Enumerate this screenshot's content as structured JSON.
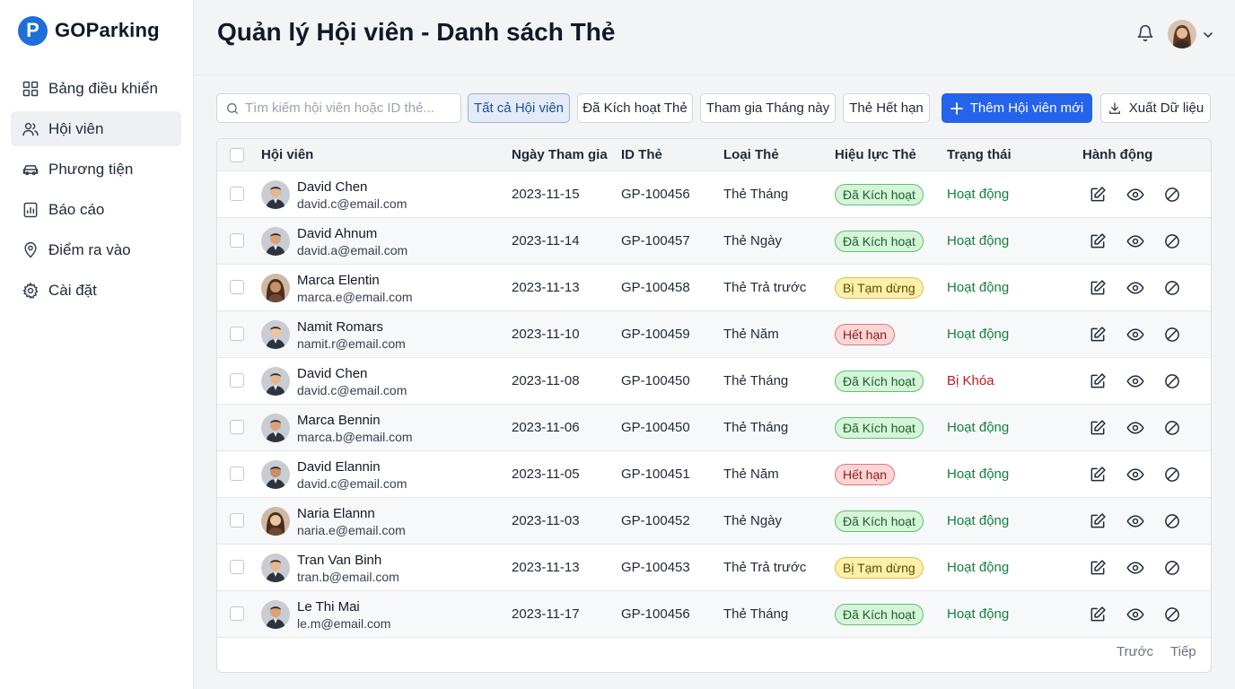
{
  "brand": {
    "name": "GOParking",
    "mark": "P"
  },
  "sidebar": {
    "items": [
      {
        "label": "Bảng điều khiển",
        "icon": "dashboard-icon"
      },
      {
        "label": "Hội viên",
        "icon": "users-icon",
        "active": true
      },
      {
        "label": "Phương tiện",
        "icon": "car-icon"
      },
      {
        "label": "Báo cáo",
        "icon": "report-icon"
      },
      {
        "label": "Điểm ra vào",
        "icon": "map-pin-icon"
      },
      {
        "label": "Cài đặt",
        "icon": "gear-icon"
      }
    ]
  },
  "header": {
    "title": "Quản lý Hội viên - Danh sách Thẻ"
  },
  "toolbar": {
    "search_placeholder": "Tìm kiếm hội viên hoặc ID thẻ...",
    "filters": [
      {
        "label": "Tất cả Hội viên",
        "active": true
      },
      {
        "label": "Đã Kích hoạt Thẻ"
      },
      {
        "label": "Tham gia Tháng này"
      },
      {
        "label": "Thẻ Hết hạn"
      }
    ],
    "add_label": "Thêm Hội viên mới",
    "export_label": "Xuất Dữ liệu"
  },
  "table": {
    "headers": {
      "member": "Hội viên",
      "joined": "Ngày Tham gia",
      "card_id": "ID Thẻ",
      "card_type": "Loại Thẻ",
      "validity": "Hiệu lực Thẻ",
      "status": "Trạng thái",
      "actions": "Hành động"
    },
    "rows": [
      {
        "name": "David Chen",
        "email": "david.c@email.com",
        "joined": "2023-11-15",
        "card_id": "GP-100456",
        "card_type": "Thẻ Tháng",
        "validity": "Đã Kích hoạt",
        "validity_tone": "green",
        "status": "Hoạt động",
        "status_tone": "active",
        "avatar": "m"
      },
      {
        "name": "David Ahnum",
        "email": "david.a@email.com",
        "joined": "2023-11-14",
        "card_id": "GP-100457",
        "card_type": "Thẻ Ngày",
        "validity": "Đã Kích hoạt",
        "validity_tone": "green",
        "status": "Hoạt động",
        "status_tone": "active",
        "avatar": "m"
      },
      {
        "name": "Marca Elentin",
        "email": "marca.e@email.com",
        "joined": "2023-11-13",
        "card_id": "GP-100458",
        "card_type": "Thẻ Trả trước",
        "validity": "Bị Tạm dừng",
        "validity_tone": "yellow",
        "status": "Hoạt động",
        "status_tone": "active",
        "avatar": "f"
      },
      {
        "name": "Namit Romars",
        "email": "namit.r@email.com",
        "joined": "2023-11-10",
        "card_id": "GP-100459",
        "card_type": "Thẻ Năm",
        "validity": "Hết hạn",
        "validity_tone": "red",
        "status": "Hoạt động",
        "status_tone": "active",
        "avatar": "m"
      },
      {
        "name": "David Chen",
        "email": "david.c@email.com",
        "joined": "2023-11-08",
        "card_id": "GP-100450",
        "card_type": "Thẻ Tháng",
        "validity": "Đã Kích hoạt",
        "validity_tone": "green",
        "status": "Bị Khóa",
        "status_tone": "locked",
        "avatar": "m"
      },
      {
        "name": "Marca Bennin",
        "email": "marca.b@email.com",
        "joined": "2023-11-06",
        "card_id": "GP-100450",
        "card_type": "Thẻ Tháng",
        "validity": "Đã Kích hoạt",
        "validity_tone": "green",
        "status": "Hoạt động",
        "status_tone": "active",
        "avatar": "m"
      },
      {
        "name": "David Elannin",
        "email": "david.c@email.com",
        "joined": "2023-11-05",
        "card_id": "GP-100451",
        "card_type": "Thẻ Năm",
        "validity": "Hết hạn",
        "validity_tone": "red",
        "status": "Hoạt động",
        "status_tone": "active",
        "avatar": "m"
      },
      {
        "name": "Naria Elannn",
        "email": "naria.e@email.com",
        "joined": "2023-11-03",
        "card_id": "GP-100452",
        "card_type": "Thẻ Ngày",
        "validity": "Đã Kích hoạt",
        "validity_tone": "green",
        "status": "Hoạt động",
        "status_tone": "active",
        "avatar": "f"
      },
      {
        "name": "Tran Van Binh",
        "email": "tran.b@email.com",
        "joined": "2023-11-13",
        "card_id": "GP-100453",
        "card_type": "Thẻ Trả trước",
        "validity": "Bị Tạm dừng",
        "validity_tone": "yellow",
        "status": "Hoạt động",
        "status_tone": "active",
        "avatar": "m"
      },
      {
        "name": "Le Thi Mai",
        "email": "le.m@email.com",
        "joined": "2023-11-17",
        "card_id": "GP-100456",
        "card_type": "Thẻ Tháng",
        "validity": "Đã Kích hoạt",
        "validity_tone": "green",
        "status": "Hoạt động",
        "status_tone": "active",
        "avatar": "m"
      }
    ]
  },
  "pagination": {
    "prev": "Trước",
    "next": "Tiếp"
  },
  "colors": {
    "accent": "#2563eb",
    "status_active": "#15803d",
    "status_locked": "#b91c1c"
  }
}
